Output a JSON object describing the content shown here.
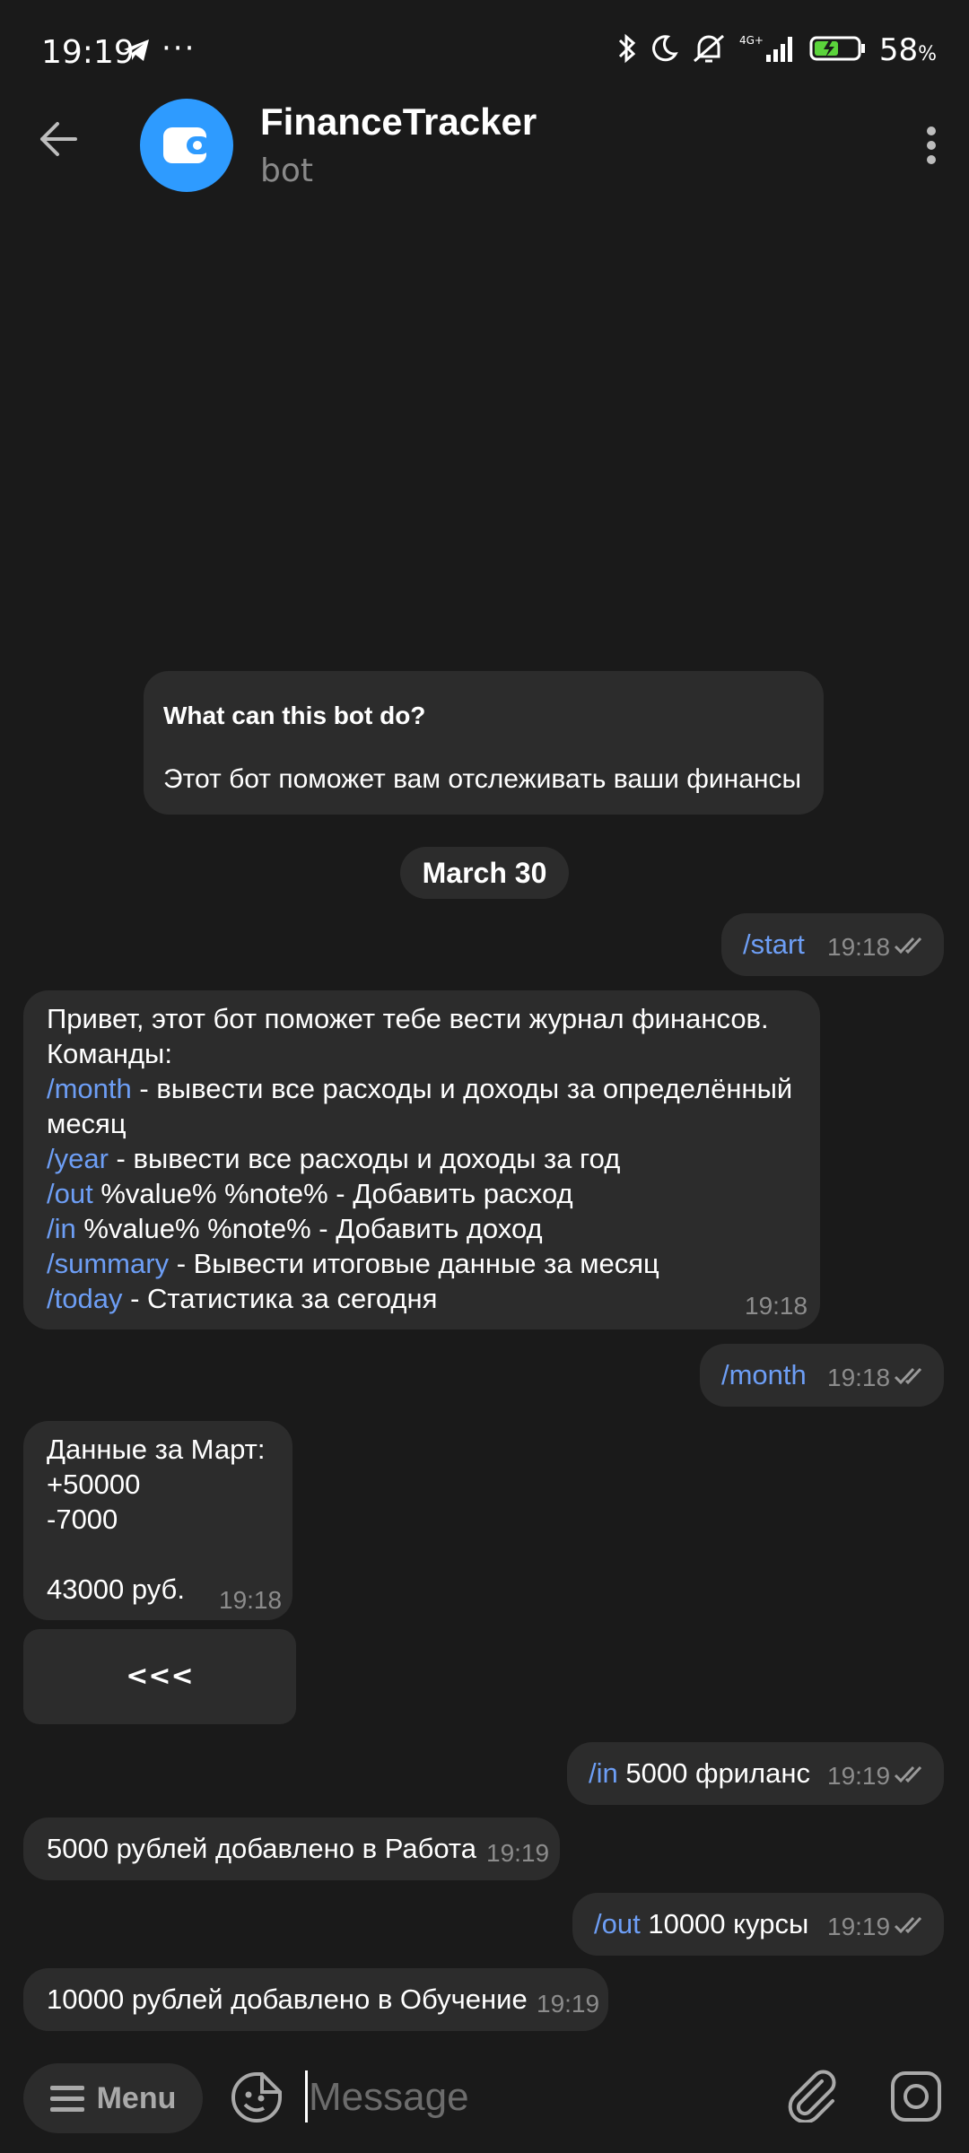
{
  "status": {
    "time": "19:19",
    "dots": "···",
    "battery_value": "58",
    "battery_unit": "%"
  },
  "header": {
    "title": "FinanceTracker",
    "subtitle": "bot"
  },
  "intro": {
    "question": "What can this bot do?",
    "answer": "Этот бот поможет вам отслеживать ваши финансы"
  },
  "date_label": "March 30",
  "messages": {
    "m1": {
      "cmd": "/start",
      "time": "19:18"
    },
    "m2": {
      "lines": [
        {
          "text": "Привет, этот бот поможет тебе вести журнал финансов."
        },
        {
          "text": "Команды:"
        },
        {
          "cmd": "/month",
          "text": " - вывести все расходы и доходы за определённый"
        },
        {
          "text": "месяц"
        },
        {
          "cmd": "/year",
          "text": " - вывести все расходы и доходы за год"
        },
        {
          "cmd": "/out",
          "text": " %value% %note% - Добавить расход"
        },
        {
          "cmd": "/in",
          "text": " %value% %note% - Добавить доход"
        },
        {
          "cmd": "/summary",
          "text": " - Вывести итоговые данные за месяц"
        },
        {
          "cmd": "/today",
          "text": " - Статистика за сегодня"
        }
      ],
      "time": "19:18"
    },
    "m3": {
      "cmd": "/month",
      "time": "19:18"
    },
    "m4": {
      "l1": "Данные за Март:",
      "l2": "+50000",
      "l3": "-7000",
      "l4": "43000 руб.",
      "time": "19:18"
    },
    "m4_button": "<<<",
    "m5": {
      "cmd": "/in",
      "text": " 5000 фриланс",
      "time": "19:19"
    },
    "m6": {
      "text": "5000 рублей добавлено в Работа",
      "time": "19:19"
    },
    "m7": {
      "cmd": "/out",
      "text": " 10000 курсы",
      "time": "19:19"
    },
    "m8": {
      "text": "10000 рублей добавлено в Обучение",
      "time": "19:19"
    }
  },
  "input": {
    "menu_label": "Menu",
    "placeholder": "Message"
  },
  "colors": {
    "background": "#1a1a1a",
    "bubble": "#2c2c2c",
    "link": "#6d9ef5",
    "accent": "#2e9bff",
    "battery": "#5bd33b"
  }
}
